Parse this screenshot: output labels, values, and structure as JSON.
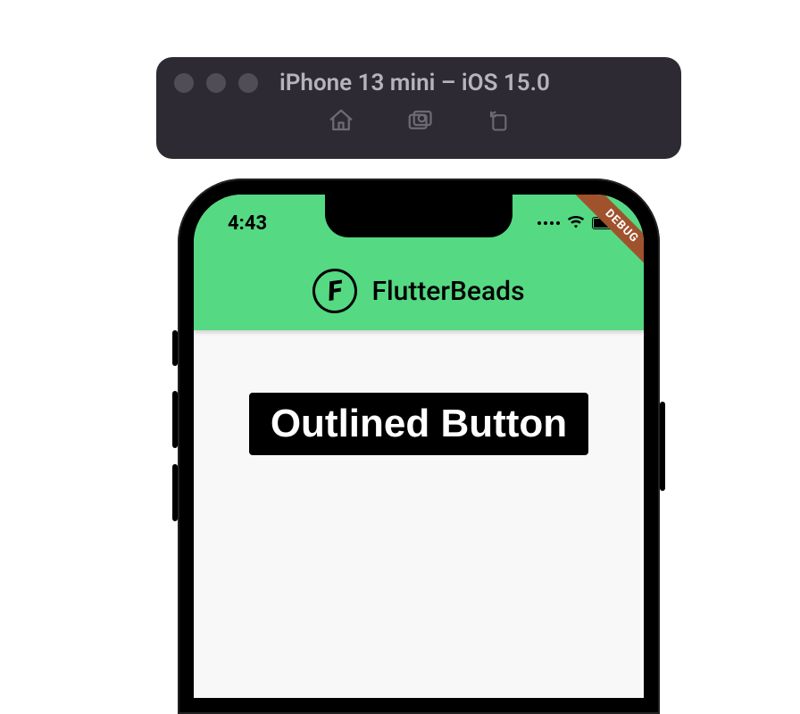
{
  "simulator": {
    "title": "iPhone 13 mini – iOS 15.0"
  },
  "status": {
    "time": "4:43"
  },
  "app": {
    "title": "FlutterBeads",
    "logo_letter": "F",
    "debug_label": "DEBUG"
  },
  "button": {
    "label": "Outlined Button"
  },
  "colors": {
    "appbar_bg": "#55d983",
    "toolbar_bg": "#2e2a33",
    "button_bg": "#000000",
    "debug_bg": "#a0522d"
  }
}
